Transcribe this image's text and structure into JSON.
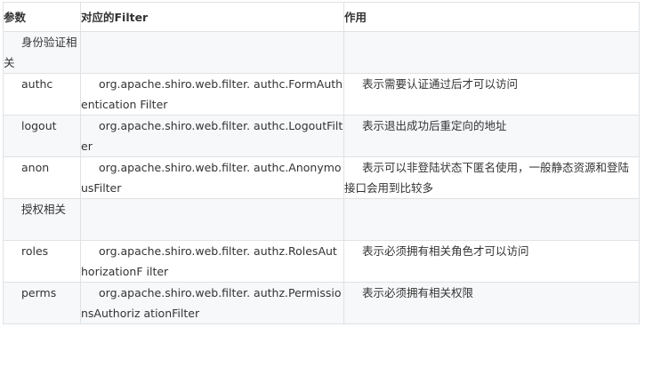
{
  "table": {
    "headers": {
      "param": "参数",
      "filter": "对应的Filter",
      "desc": "作用"
    },
    "rows": [
      {
        "param": "身份验证相关",
        "filter": "",
        "desc": ""
      },
      {
        "param": "authc",
        "filter": "org.apache.shiro.web.filter. authc.FormAuthentication Filter",
        "desc": "表示需要认证通过后才可以访问"
      },
      {
        "param": "logout",
        "filter": "org.apache.shiro.web.filter. authc.LogoutFilter",
        "desc": "表示退出成功后重定向的地址"
      },
      {
        "param": "anon",
        "filter": "org.apache.shiro.web.filter. authc.AnonymousFilter",
        "desc": "表示可以非登陆状态下匿名使用，一般静态资源和登陆接口会用到比较多"
      },
      {
        "param": "授权相关",
        "filter": "",
        "desc": ""
      },
      {
        "param": "roles",
        "filter": "org.apache.shiro.web.filter. authz.RolesAuthorizationF ilter",
        "desc": "表示必须拥有相关角色才可以访问"
      },
      {
        "param": "perms",
        "filter": "org.apache.shiro.web.filter. authz.PermissionsAuthoriz ationFilter",
        "desc": "表示必须拥有相关权限"
      }
    ]
  }
}
